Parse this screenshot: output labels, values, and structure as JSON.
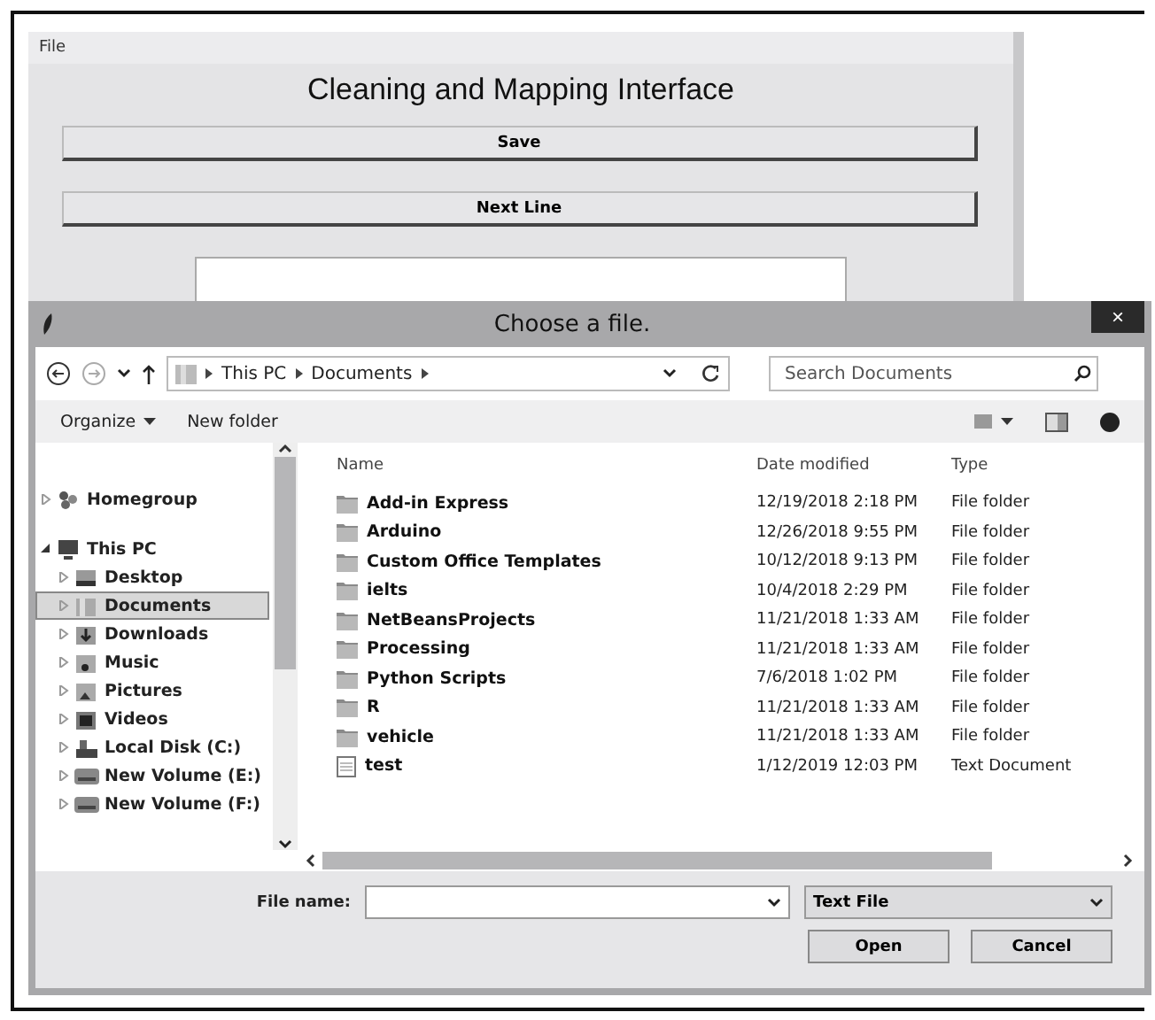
{
  "app": {
    "menu": [
      "File"
    ],
    "title": "Cleaning and Mapping Interface",
    "buttons": [
      "Save",
      "Next Line"
    ]
  },
  "dialog": {
    "title": "Choose a file.",
    "close": "×",
    "breadcrumb": [
      "This PC",
      "Documents"
    ],
    "search": {
      "placeholder": "Search Documents"
    },
    "toolbar": [
      "Organize",
      "New folder"
    ],
    "nav": [
      {
        "label": "Homegroup",
        "kind": "group",
        "expanded": false,
        "selected": false
      },
      {
        "label": "This PC",
        "kind": "pc",
        "expanded": true,
        "selected": false,
        "children": [
          {
            "label": "Desktop",
            "kind": "desktop",
            "expanded": false,
            "selected": false
          },
          {
            "label": "Documents",
            "kind": "folder",
            "expanded": false,
            "selected": true
          },
          {
            "label": "Downloads",
            "kind": "download",
            "expanded": false,
            "selected": false
          },
          {
            "label": "Music",
            "kind": "music",
            "expanded": false,
            "selected": false
          },
          {
            "label": "Pictures",
            "kind": "pictures",
            "expanded": false,
            "selected": false
          },
          {
            "label": "Videos",
            "kind": "video",
            "expanded": false,
            "selected": false
          },
          {
            "label": "Local Disk (C:)",
            "kind": "disk",
            "expanded": false,
            "selected": false
          },
          {
            "label": "New Volume (E:)",
            "kind": "drive",
            "expanded": false,
            "selected": false
          },
          {
            "label": "New Volume (F:)",
            "kind": "drive",
            "expanded": false,
            "selected": false
          }
        ]
      }
    ],
    "columns": [
      "Name",
      "Date modified",
      "Type"
    ],
    "files": [
      {
        "name": "Add-in Express",
        "date": "12/19/2018 2:18 PM",
        "type": "File folder",
        "kind": "folder"
      },
      {
        "name": "Arduino",
        "date": "12/26/2018 9:55 PM",
        "type": "File folder",
        "kind": "folder"
      },
      {
        "name": "Custom Office Templates",
        "date": "10/12/2018 9:13 PM",
        "type": "File folder",
        "kind": "folder"
      },
      {
        "name": "ielts",
        "date": "10/4/2018 2:29 PM",
        "type": "File folder",
        "kind": "folder"
      },
      {
        "name": "NetBeansProjects",
        "date": "11/21/2018 1:33 AM",
        "type": "File folder",
        "kind": "folder"
      },
      {
        "name": "Processing",
        "date": "11/21/2018 1:33 AM",
        "type": "File folder",
        "kind": "folder"
      },
      {
        "name": "Python Scripts",
        "date": "7/6/2018 1:02 PM",
        "type": "File folder",
        "kind": "folder"
      },
      {
        "name": "R",
        "date": "11/21/2018 1:33 AM",
        "type": "File folder",
        "kind": "folder"
      },
      {
        "name": "vehicle",
        "date": "11/21/2018 1:33 AM",
        "type": "File folder",
        "kind": "folder"
      },
      {
        "name": "test",
        "date": "1/12/2019 12:03 PM",
        "type": "Text Document",
        "kind": "text"
      }
    ],
    "file_name_label": "File name:",
    "file_type": "Text File",
    "buttons": [
      "Open",
      "Cancel"
    ]
  }
}
